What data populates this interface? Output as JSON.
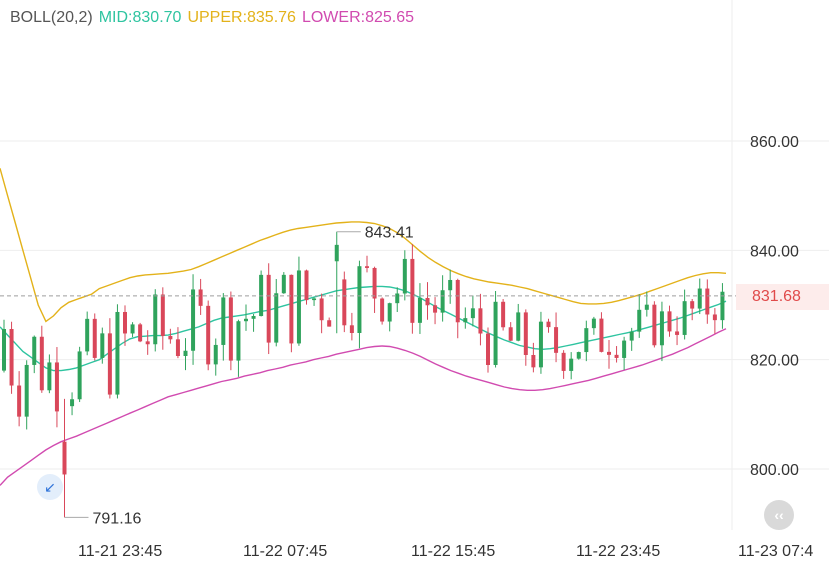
{
  "indicator": {
    "name": "BOLL(20,2)",
    "mid_label": "MID:830.70",
    "upper_label": "UPPER:835.76",
    "lower_label": "LOWER:825.65"
  },
  "colors": {
    "up": "#2fa35c",
    "down": "#d9475a",
    "mid": "#2ec4a0",
    "upper": "#e3b21a",
    "lower": "#d14bb0",
    "grid": "#eeeeee",
    "current_line": "#9e9e9e"
  },
  "current_price": {
    "label": "831.68",
    "value": 831.68
  },
  "annotations": {
    "high_label": "843.41",
    "low_label": "791.16"
  },
  "ui": {
    "scroll_icon": "double-chevron-left-icon",
    "low_icon": "arrow-down-left-icon"
  },
  "chart_data": {
    "type": "candlestick",
    "y_axis": {
      "ticks": [
        800,
        820,
        840,
        860
      ],
      "labels": [
        "800.00",
        "820.00",
        "840.00",
        "860.00"
      ],
      "side": "right"
    },
    "x_axis": {
      "labels": [
        "11-21 23:45",
        "11-22 07:45",
        "11-22 15:45",
        "11-22 23:45",
        "11-23 07:4"
      ]
    },
    "grid": true,
    "legend": "top-left",
    "high": 843.41,
    "low": 791.16,
    "series": [
      {
        "name": "MID",
        "values": [
          826,
          824.5,
          823,
          821.5,
          820.5,
          819.5,
          818.5,
          818,
          818,
          818.2,
          818.5,
          819,
          819.5,
          820,
          821,
          822,
          823,
          823.8,
          824.2,
          824.3,
          824.4,
          824.4,
          824.5,
          824.8,
          825.2,
          825.6,
          826,
          826.6,
          827.2,
          827.6,
          827.8,
          828,
          828.2,
          828.5,
          828.8,
          829,
          829.4,
          829.8,
          830.2,
          830.6,
          831,
          831.4,
          831.8,
          832.2,
          832.6,
          832.8,
          833,
          833.2,
          833.3,
          833.4,
          833.4,
          833.3,
          833,
          832.6,
          832,
          831.3,
          830.5,
          829.7,
          829,
          828.3,
          827.6,
          826.9,
          826.2,
          825.5,
          824.8,
          824.2,
          823.6,
          823.1,
          822.6,
          822.3,
          822,
          821.9,
          822,
          822.2,
          822.5,
          822.8,
          823.1,
          823.4,
          823.7,
          824,
          824.3,
          824.6,
          824.9,
          825.2,
          825.6,
          826,
          826.4,
          826.8,
          827.2,
          827.6,
          828.1,
          828.6,
          829.1,
          829.6,
          830.1,
          830.7
        ]
      },
      {
        "name": "UPPER",
        "values": [
          855,
          850,
          845,
          840,
          835,
          830,
          827,
          828,
          829.5,
          830.5,
          831,
          831.5,
          832,
          833,
          833.5,
          834,
          834.5,
          835,
          835.3,
          835.5,
          835.6,
          835.7,
          835.8,
          836,
          836.2,
          836.5,
          837,
          837.6,
          838.2,
          838.8,
          839.4,
          840,
          840.6,
          841.2,
          841.8,
          842.3,
          842.8,
          843.3,
          843.7,
          844,
          844.2,
          844.4,
          844.6,
          844.8,
          845,
          845.1,
          845.2,
          845.2,
          845.1,
          844.9,
          844.5,
          844,
          843.2,
          842.2,
          841,
          839.8,
          838.7,
          837.8,
          837,
          836.3,
          835.7,
          835.2,
          834.8,
          834.5,
          834.2,
          834,
          833.8,
          833.6,
          833.3,
          833,
          832.6,
          832.2,
          831.8,
          831.4,
          831,
          830.6,
          830.3,
          830.2,
          830.2,
          830.3,
          830.5,
          830.8,
          831.2,
          831.6,
          832,
          832.5,
          833,
          833.5,
          834,
          834.5,
          835,
          835.4,
          835.7,
          835.9,
          835.9,
          835.8
        ]
      },
      {
        "name": "LOWER",
        "values": [
          797,
          798.5,
          799.5,
          800.5,
          801.5,
          802.5,
          803.5,
          804.3,
          805,
          805.5,
          806,
          806.6,
          807.2,
          807.8,
          808.4,
          809,
          809.6,
          810.2,
          810.8,
          811.4,
          812,
          812.6,
          813.2,
          813.6,
          814,
          814.4,
          814.8,
          815.2,
          815.6,
          816,
          816.3,
          816.6,
          817,
          817.3,
          817.6,
          818,
          818.3,
          818.6,
          819,
          819.3,
          819.6,
          820,
          820.3,
          820.6,
          821,
          821.3,
          821.6,
          821.9,
          822.2,
          822.4,
          822.5,
          822.4,
          822.1,
          821.7,
          821.2,
          820.6,
          819.9,
          819.2,
          818.6,
          818,
          817.5,
          817,
          816.6,
          816.2,
          815.8,
          815.4,
          815,
          814.7,
          814.5,
          814.4,
          814.4,
          814.5,
          814.7,
          815,
          815.3,
          815.6,
          815.9,
          816.2,
          816.6,
          817,
          817.4,
          817.8,
          818.2,
          818.6,
          819,
          819.5,
          820,
          820.5,
          821,
          821.6,
          822.2,
          822.9,
          823.6,
          824.3,
          825,
          825.65
        ]
      }
    ],
    "candles": []
  }
}
